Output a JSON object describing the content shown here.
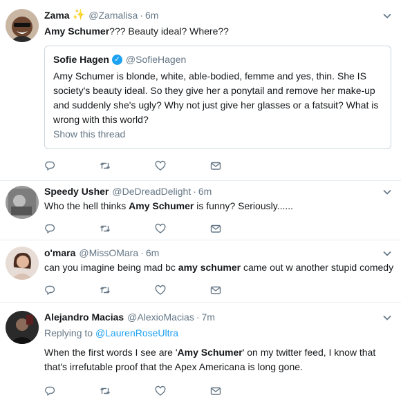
{
  "tweets": [
    {
      "name": "Zama",
      "name_emoji": "✨",
      "handle": "@Zamalisa",
      "dot": "·",
      "time": "6m",
      "text_parts": [
        {
          "t": "Amy Schumer",
          "bold": true
        },
        {
          "t": "??? Beauty ideal? Where??",
          "bold": false
        }
      ],
      "quote": {
        "name": "Sofie Hagen",
        "verified_icon": "verified-badge",
        "handle": "@SofieHagen",
        "text": "Amy Schumer is blonde, white, able-bodied, femme and yes, thin. She IS society's beauty ideal. So they give her a ponytail and remove her make-up and suddenly she's ugly? Why not just give her glasses or a fatsuit? What is wrong with this world?",
        "show_thread": "Show this thread"
      }
    },
    {
      "name": "Speedy Usher",
      "handle": "@DeDreadDelight",
      "dot": "·",
      "time": "6m",
      "text_parts": [
        {
          "t": "Who the hell thinks ",
          "bold": false
        },
        {
          "t": "Amy Schumer",
          "bold": true
        },
        {
          "t": " is funny? Seriously......",
          "bold": false
        }
      ]
    },
    {
      "name": "o'mara",
      "handle": "@MissOMara",
      "dot": "·",
      "time": "6m",
      "text_parts": [
        {
          "t": "can you imagine being mad bc ",
          "bold": false
        },
        {
          "t": "amy schumer",
          "bold": true
        },
        {
          "t": " came out w another stupid comedy",
          "bold": false
        }
      ]
    },
    {
      "name": "Alejandro Macias",
      "handle": "@AlexioMacias",
      "dot": "·",
      "time": "7m",
      "replying_prefix": "Replying to",
      "replying_to": "@LaurenRoseUltra",
      "text_parts": [
        {
          "t": "When the first words I see are '",
          "bold": false
        },
        {
          "t": "Amy Schumer",
          "bold": true
        },
        {
          "t": "' on my twitter feed, I know that that's irrefutable proof that the Apex Americana is long gone.",
          "bold": false
        }
      ]
    }
  ],
  "icons": {
    "reply": "reply-icon",
    "retweet": "retweet-icon",
    "like": "heart-icon",
    "dm": "envelope-icon",
    "caret": "chevron-down-icon"
  },
  "colors": {
    "text": "#14171a",
    "muted": "#657786",
    "link": "#1da1f2",
    "border": "#e6ecf0",
    "icon": "#657786"
  }
}
